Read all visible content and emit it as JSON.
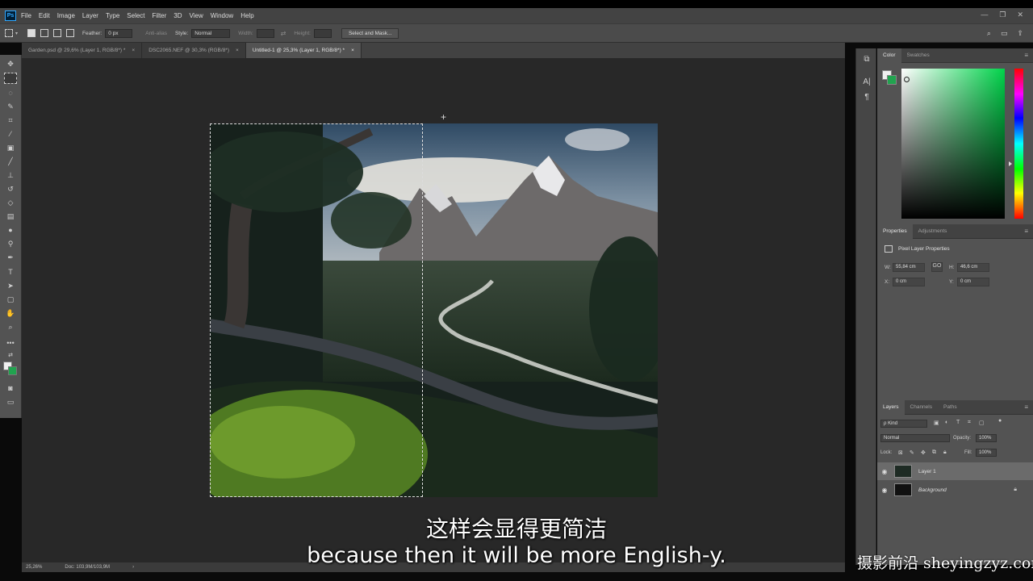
{
  "app": {
    "logo": "Ps",
    "menu": [
      "File",
      "Edit",
      "Image",
      "Layer",
      "Type",
      "Select",
      "Filter",
      "3D",
      "View",
      "Window",
      "Help"
    ],
    "window_controls": [
      "—",
      "❐",
      "✕"
    ]
  },
  "options_bar": {
    "feather_label": "Feather:",
    "feather_value": "0 px",
    "antialias_label": "Anti-alias",
    "style_label": "Style:",
    "style_value": "Normal",
    "width_label": "Width:",
    "height_label": "Height:",
    "select_mask_label": "Select and Mask..."
  },
  "tabs": [
    {
      "label": "Garden.psd @ 29,6% (Layer 1, RGB/8*) *",
      "close": "×"
    },
    {
      "label": "DSC2065.NEF @ 30,3% (RGB/8*)",
      "close": "×"
    },
    {
      "label": "Untitled-1 @ 25,3% (Layer 1, RGB/8*) *",
      "close": "×"
    }
  ],
  "status": {
    "zoom": "25,26%",
    "doc": "Doc: 103,9M/103,9M",
    "arrow": "›"
  },
  "color_panel": {
    "tabs": [
      "Color",
      "Swatches"
    ],
    "accent_fg": "#f0f0f0",
    "accent_bg": "#21a34f"
  },
  "properties_panel": {
    "tabs": [
      "Properties",
      "Adjustments"
    ],
    "title": "Pixel Layer Properties",
    "w_label": "W:",
    "w_value": "55,84 cm",
    "h_label": "H:",
    "h_value": "46,6 cm",
    "x_label": "X:",
    "x_value": "0 cm",
    "y_label": "Y:",
    "y_value": "0 cm",
    "link_icon": "GO"
  },
  "layers_panel": {
    "tabs": [
      "Layers",
      "Channels",
      "Paths"
    ],
    "kind_label": "ρ Kind",
    "blend_mode": "Normal",
    "opacity_label": "Opacity:",
    "opacity_value": "100%",
    "lock_label": "Lock:",
    "fill_label": "Fill:",
    "fill_value": "100%",
    "layers": [
      {
        "name": "Layer 1",
        "selected": true
      },
      {
        "name": "Background",
        "selected": false
      }
    ]
  },
  "subtitles": {
    "chinese": "这样会显得更简洁",
    "english": "because then it will be more English-y."
  },
  "watermark": "摄影前沿 sheyingzyz.com"
}
